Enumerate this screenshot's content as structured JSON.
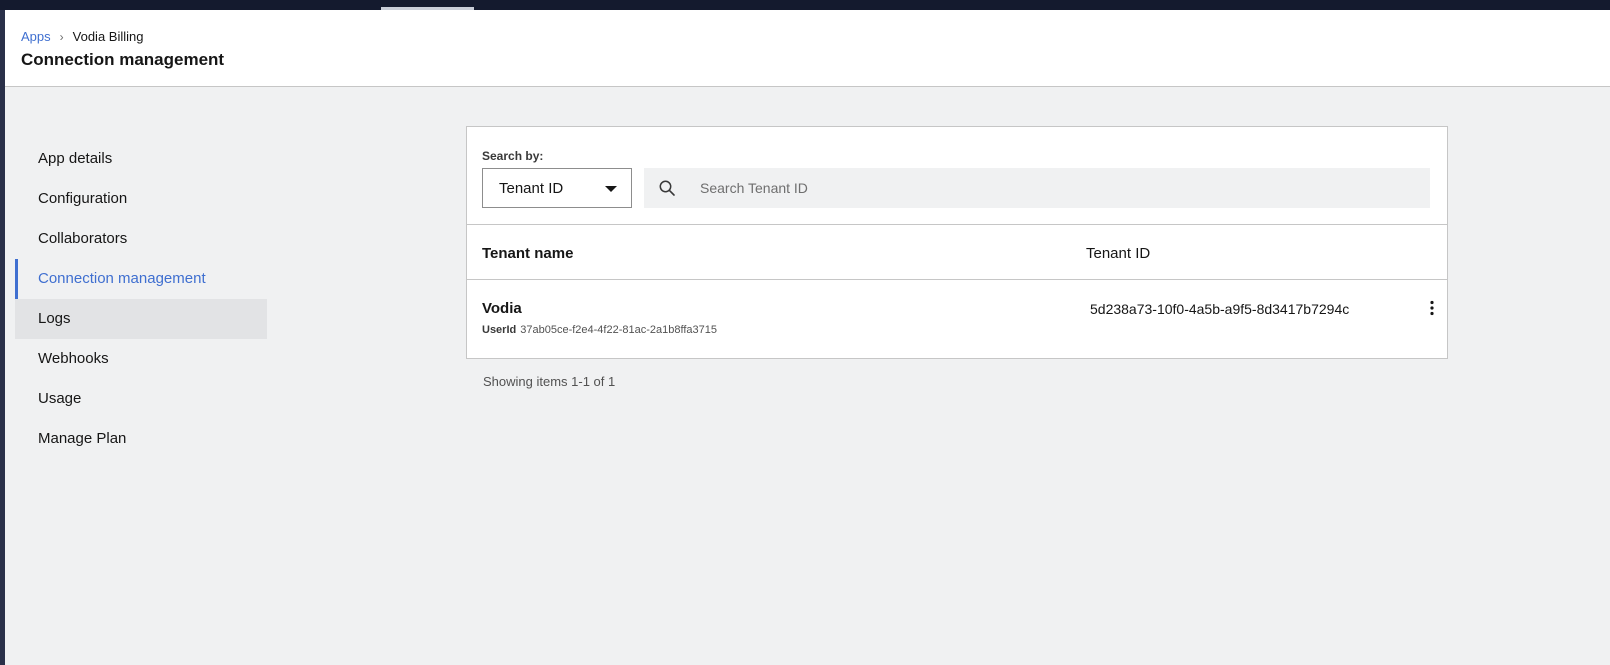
{
  "header": {
    "breadcrumb": [
      {
        "label": "Apps"
      },
      {
        "label": "Vodia Billing"
      }
    ],
    "title": "Connection management"
  },
  "sidebar": {
    "items": [
      {
        "label": "App details"
      },
      {
        "label": "Configuration"
      },
      {
        "label": "Collaborators"
      },
      {
        "label": "Connection management",
        "active": true
      },
      {
        "label": "Logs",
        "hovered": true
      },
      {
        "label": "Webhooks"
      },
      {
        "label": "Usage"
      },
      {
        "label": "Manage Plan"
      }
    ]
  },
  "search": {
    "label": "Search by:",
    "selected_option": "Tenant ID",
    "placeholder": "Search Tenant ID",
    "value": ""
  },
  "table": {
    "columns": [
      "Tenant name",
      "Tenant ID"
    ],
    "rows": [
      {
        "tenant_name": "Vodia",
        "user_id_label": "UserId",
        "user_id": "37ab05ce-f2e4-4f22-81ac-2a1b8ffa3715",
        "tenant_id": "5d238a73-10f0-4a5b-a9f5-8d3417b7294c"
      }
    ]
  },
  "pagination": {
    "text": "Showing items 1-1 of 1"
  },
  "colors": {
    "accent": "#3f6fd0",
    "page_bg": "#f0f1f2",
    "panel_bg": "#ffffff",
    "border": "#c6c6c6"
  },
  "icons": {
    "search": "search-icon",
    "dropdown": "chevron-down-icon",
    "row_menu": "overflow-menu-icon"
  }
}
